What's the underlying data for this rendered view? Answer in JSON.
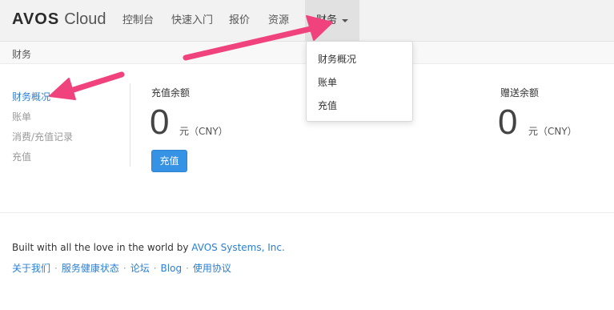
{
  "brand": {
    "strong": "AVOS",
    "light": "Cloud"
  },
  "nav": {
    "items": [
      "控制台",
      "快速入门",
      "报价",
      "资源"
    ],
    "active": "财务"
  },
  "breadcrumb": "财务",
  "dropdown": {
    "items": [
      "财务概况",
      "账单",
      "充值"
    ]
  },
  "sidebar": {
    "items": [
      "财务概况",
      "账单",
      "消费/充值记录",
      "充值"
    ],
    "active_index": 0
  },
  "balances": {
    "recharge": {
      "label": "充值余额",
      "value": "0",
      "unit": "元（CNY）"
    },
    "gift": {
      "label": "赠送余额",
      "value": "0",
      "unit": "元（CNY）"
    }
  },
  "recharge_button": "充值",
  "footer": {
    "text": "Built with all the love in the world by ",
    "company": "AVOS Systems, Inc.",
    "links": [
      "关于我们",
      "服务健康状态",
      "论坛",
      "Blog",
      "使用协议"
    ],
    "separator": "·"
  },
  "colors": {
    "accent": "#2a7fd4",
    "button": "#3592e4",
    "annotation_arrow": "#f0427c"
  }
}
